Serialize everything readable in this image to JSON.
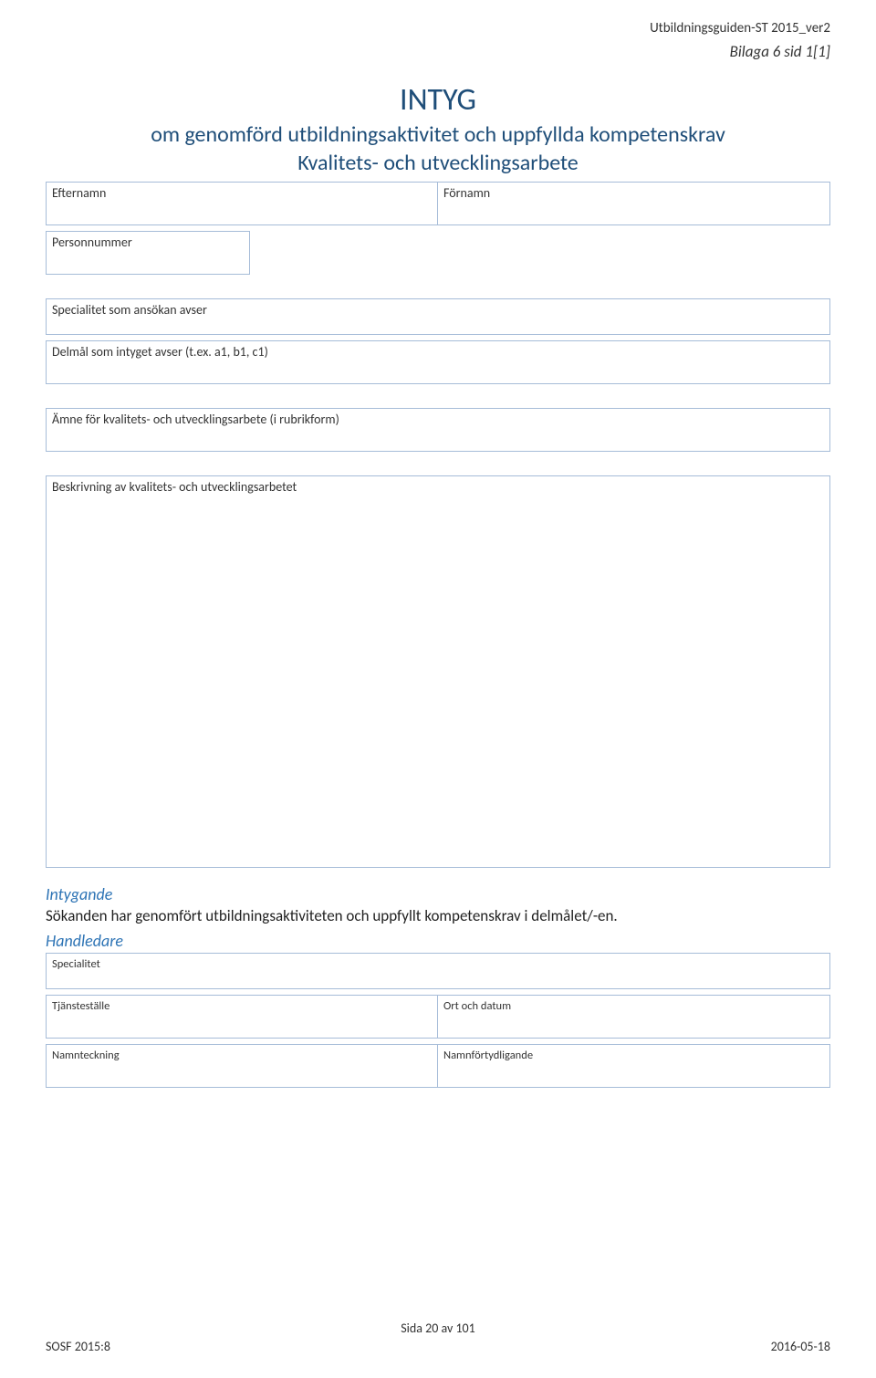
{
  "header": {
    "doc_version": "Utbildningsguiden-ST 2015_ver2",
    "bilaga": "Bilaga 6 sid 1[1]"
  },
  "title": {
    "main": "INTYG",
    "line2": "om genomförd utbildningsaktivitet och uppfyllda kompetenskrav",
    "line3": "Kvalitets- och utvecklingsarbete"
  },
  "fields": {
    "efternamn": "Efternamn",
    "fornamn": "Förnamn",
    "personnummer": "Personnummer",
    "specialitet_ansokan": "Specialitet som ansökan avser",
    "delmal": "Delmål som intyget avser (t.ex. a1, b1, c1)",
    "amne": "Ämne för kvalitets- och utvecklingsarbete (i rubrikform)",
    "beskrivning": "Beskrivning av kvalitets- och utvecklingsarbetet"
  },
  "intygande": {
    "heading": "Intygande",
    "text": "Sökanden har genomfört utbildningsaktiviteten och uppfyllt kompetenskrav i delmålet/-en."
  },
  "handledare": {
    "heading": "Handledare",
    "specialitet": "Specialitet",
    "tjanstestalle": "Tjänsteställe",
    "ort_datum": "Ort och datum",
    "namnteckning": "Namnteckning",
    "namnfortydligande": "Namnförtydligande"
  },
  "footer": {
    "left": "SOSF 2015:8",
    "center": "Sida 20 av 101",
    "right": "2016-05-18"
  }
}
